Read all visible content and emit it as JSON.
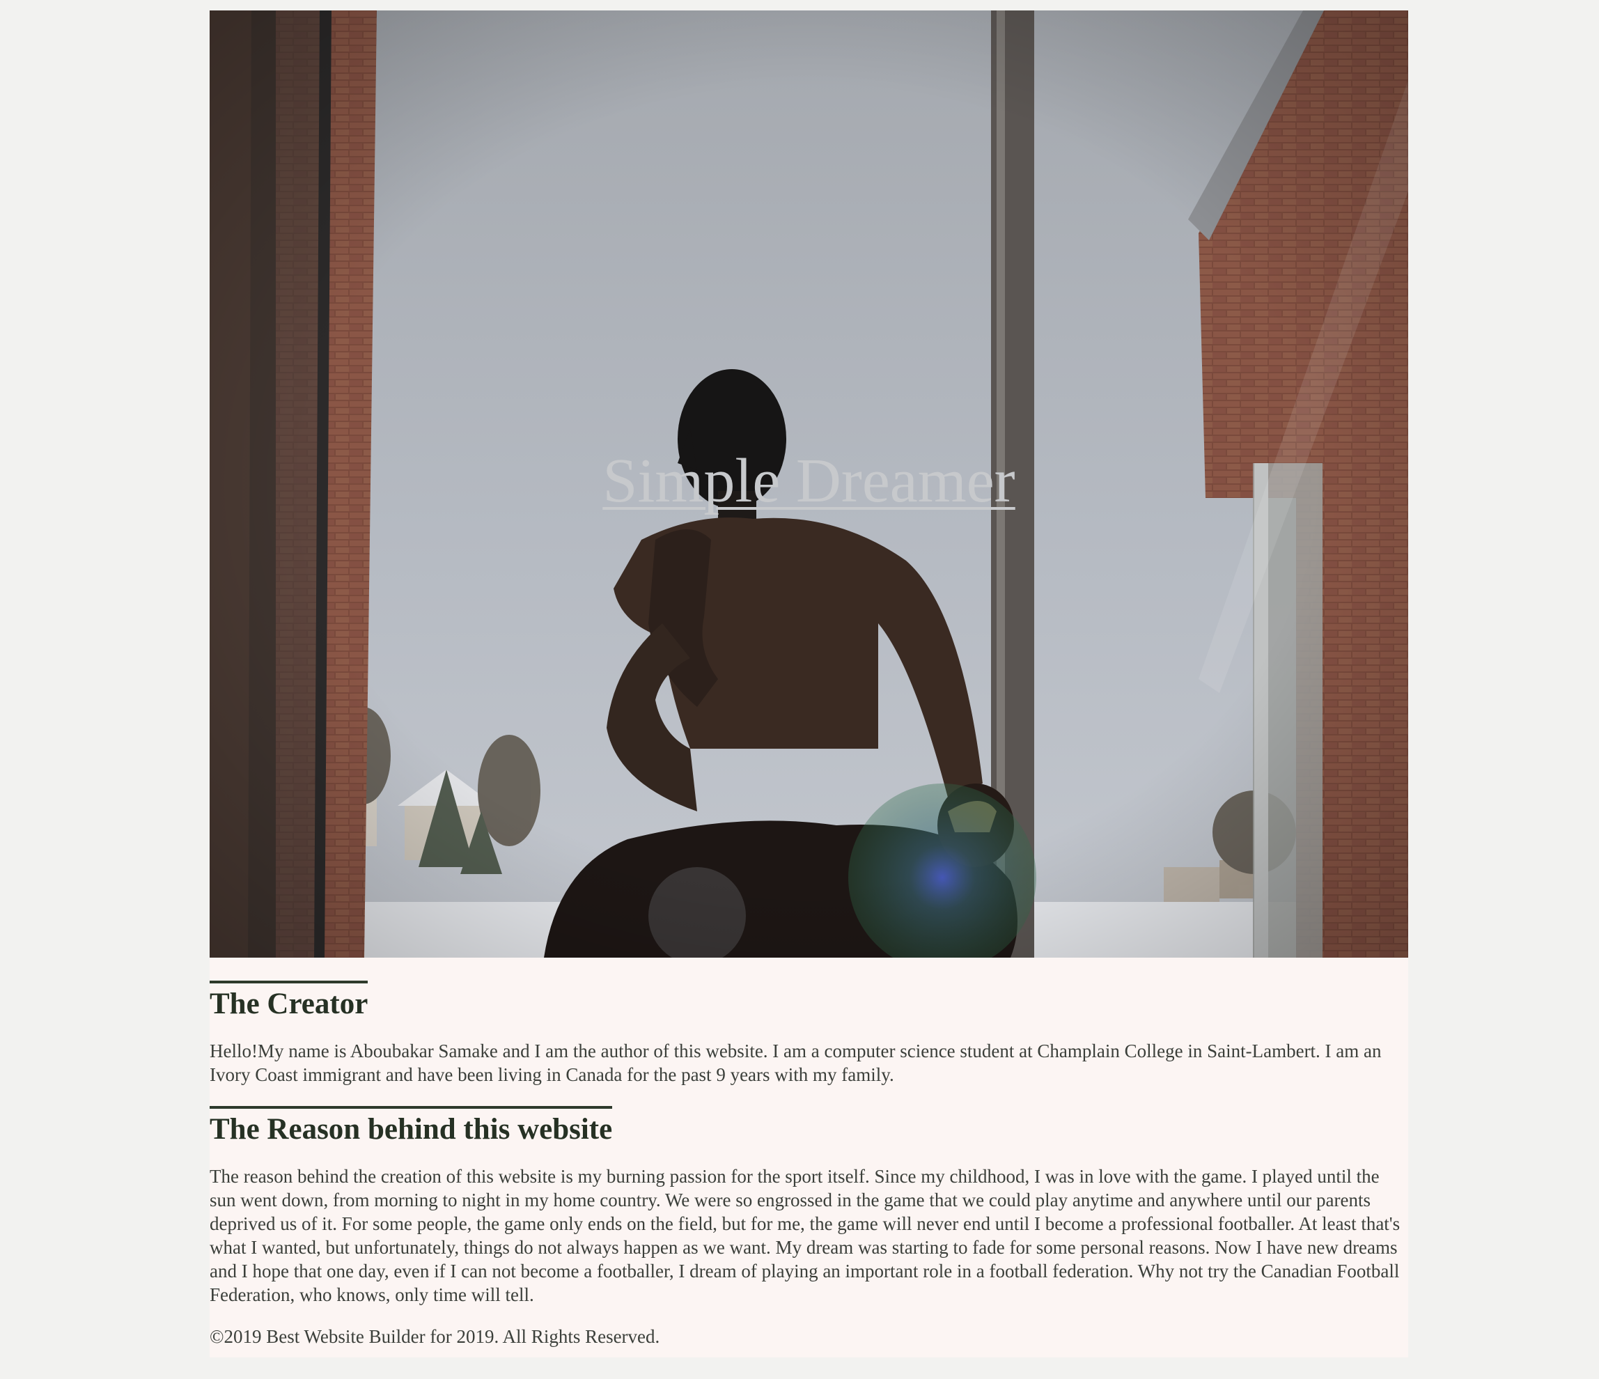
{
  "hero": {
    "title": "Simple Dreamer"
  },
  "creator": {
    "heading": "The Creator",
    "text": "Hello!My name is Aboubakar Samake and I am the author of this website. I am a computer science student at Champlain College in Saint-Lambert. I am an Ivory Coast immigrant and have been living in Canada for the past 9 years with my family."
  },
  "reason": {
    "heading": "The Reason behind this website",
    "text": "The reason behind the creation of this website is my burning passion for the sport itself. Since my childhood, I was in love with the game. I played until the sun went down, from morning to night in my home country. We were so engrossed in the game that we could play anytime and anywhere until our parents deprived us of it. For some people, the game only ends on the field, but for me, the game will never end until I become a professional footballer. At least that's what I wanted, but unfortunately, things do not always happen as we want. My dream was starting to fade for some personal reasons. Now I have new dreams and I hope that one day, even if I can not become a footballer, I dream of playing an important role in a football federation. Why not try the Canadian Football Federation, who knows, only time will tell."
  },
  "footer": {
    "text": "©2019 Best Website Builder for 2019. All Rights Reserved."
  }
}
